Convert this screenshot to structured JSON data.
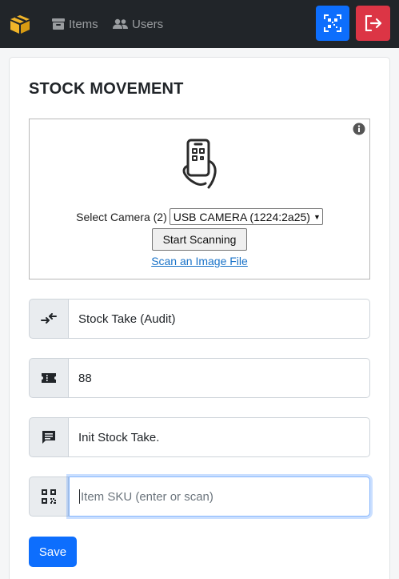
{
  "navbar": {
    "brand_icon": "box-open-icon",
    "items_label": "Items",
    "users_label": "Users",
    "scan_icon": "qr-scan-icon",
    "logout_icon": "sign-out-icon",
    "colors": {
      "bg": "#212529",
      "scan": "#0d6efd",
      "logout": "#dc3545",
      "brand": "#f0b429"
    }
  },
  "page": {
    "title": "STOCK MOVEMENT"
  },
  "scanner": {
    "camera_label": "Select Camera (2)",
    "camera_selected": "USB CAMERA (1224:2a25)",
    "start_label": "Start Scanning",
    "scan_file_label": "Scan an Image File"
  },
  "form": {
    "movement_type": {
      "icon": "exchange-icon",
      "value": "Stock Take (Audit)"
    },
    "ticket": {
      "icon": "ticket-icon",
      "value": "88"
    },
    "note": {
      "icon": "comment-icon",
      "value": "Init Stock Take."
    },
    "sku": {
      "icon": "qrcode-icon",
      "value": "",
      "placeholder": "Item SKU (enter or scan)"
    }
  },
  "actions": {
    "save_label": "Save"
  }
}
